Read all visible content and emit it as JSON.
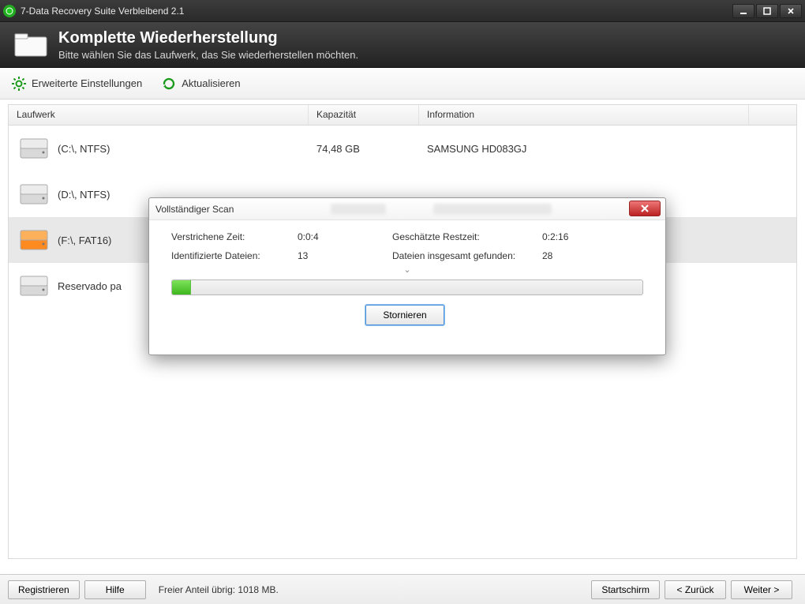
{
  "window": {
    "title": "7-Data Recovery Suite Verbleibend 2.1"
  },
  "header": {
    "title": "Komplette Wiederherstellung",
    "subtitle": "Bitte wählen Sie das Laufwerk, das Sie wiederherstellen möchten."
  },
  "toolbar": {
    "advanced": "Erweiterte Einstellungen",
    "refresh": "Aktualisieren"
  },
  "columns": {
    "drive": "Laufwerk",
    "capacity": "Kapazität",
    "info": "Information"
  },
  "drives": [
    {
      "label": "(C:\\, NTFS)",
      "capacity": "74,48 GB",
      "info": "SAMSUNG HD083GJ",
      "selected": false,
      "highlight": false
    },
    {
      "label": "(D:\\, NTFS)",
      "capacity": "",
      "info": "",
      "selected": false,
      "highlight": false
    },
    {
      "label": "(F:\\, FAT16)",
      "capacity": "",
      "info": "",
      "selected": true,
      "highlight": true
    },
    {
      "label": "Reservado pa",
      "capacity": "",
      "info": "",
      "selected": false,
      "highlight": false
    }
  ],
  "dialog": {
    "title": "Vollständiger Scan",
    "elapsed_label": "Verstrichene Zeit:",
    "elapsed_value": "0:0:4",
    "remaining_label": "Geschätzte Restzeit:",
    "remaining_value": "0:2:16",
    "identified_label": "Identifizierte Dateien:",
    "identified_value": "13",
    "total_label": "Dateien insgesamt gefunden:",
    "total_value": "28",
    "progress_percent": 4,
    "cancel": "Stornieren"
  },
  "footer": {
    "register": "Registrieren",
    "help": "Hilfe",
    "free_space": "Freier Anteil übrig: 1018 MB.",
    "home": "Startschirm",
    "back": "<  Zurück",
    "next": "Weiter  >"
  }
}
